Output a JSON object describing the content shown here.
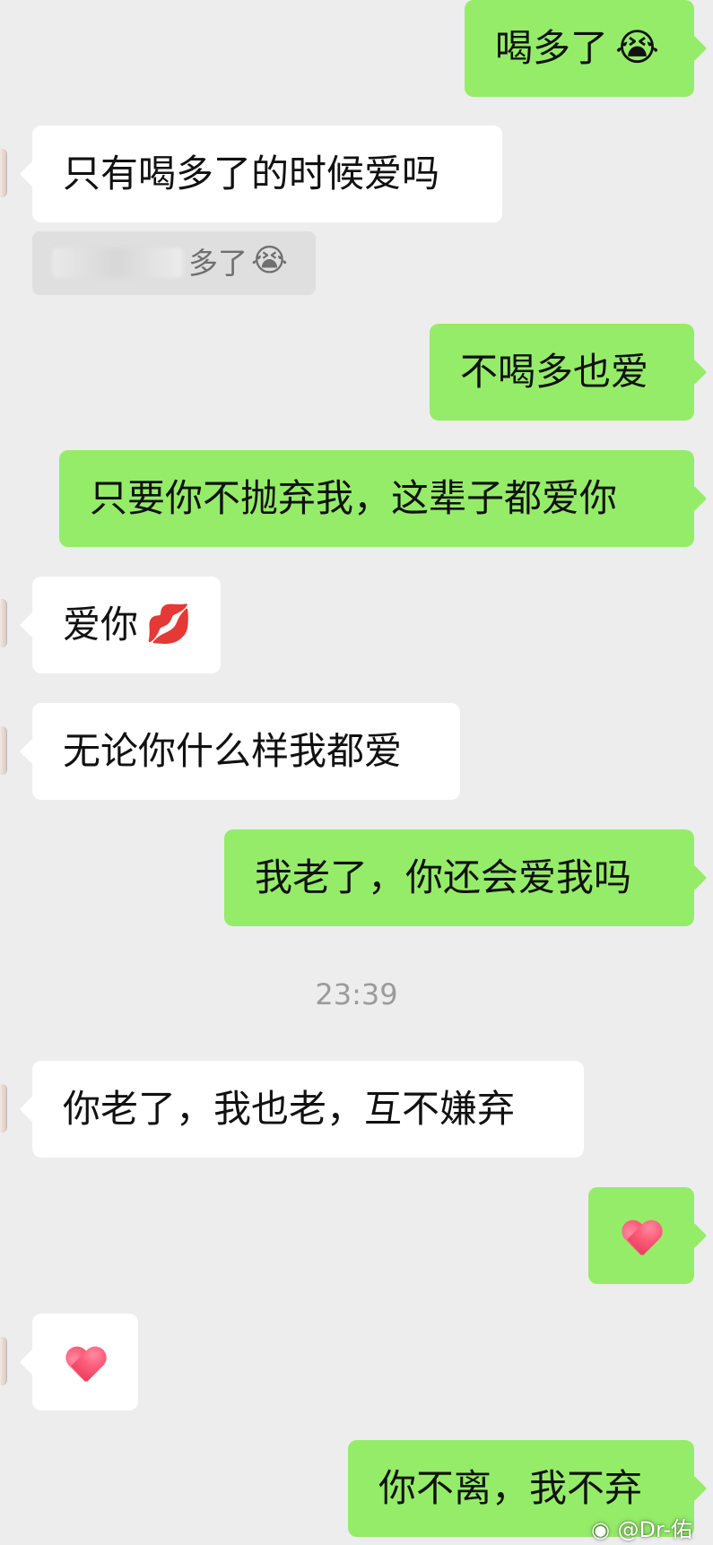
{
  "conversation": {
    "messages": [
      {
        "text": "喝多了",
        "emoji": "😭"
      },
      {
        "text": "只有喝多了的时候爱吗"
      },
      {
        "text": "不喝多也爱"
      },
      {
        "text": "只要你不抛弃我，这辈子都爱你"
      },
      {
        "text": "爱你",
        "emoji": "💋"
      },
      {
        "text": "无论你什么样我都爱"
      },
      {
        "text": "我老了，你还会爱我吗"
      },
      {
        "text": "你老了，我也老，互不嫌弃"
      },
      {
        "text": "你不离，我不弃"
      }
    ],
    "quote": {
      "text": "多了",
      "emoji": "😭"
    },
    "timestamp": "23:39"
  },
  "watermark": {
    "text": "@Dr-佑",
    "icon": "weibo-icon"
  },
  "colors": {
    "background": "#ededed",
    "incoming_bubble": "#ffffff",
    "outgoing_bubble": "#95ec69",
    "timestamp": "#9b9b9b",
    "quote_background": "#dfdfdf",
    "quote_text": "#6f6f6f"
  }
}
